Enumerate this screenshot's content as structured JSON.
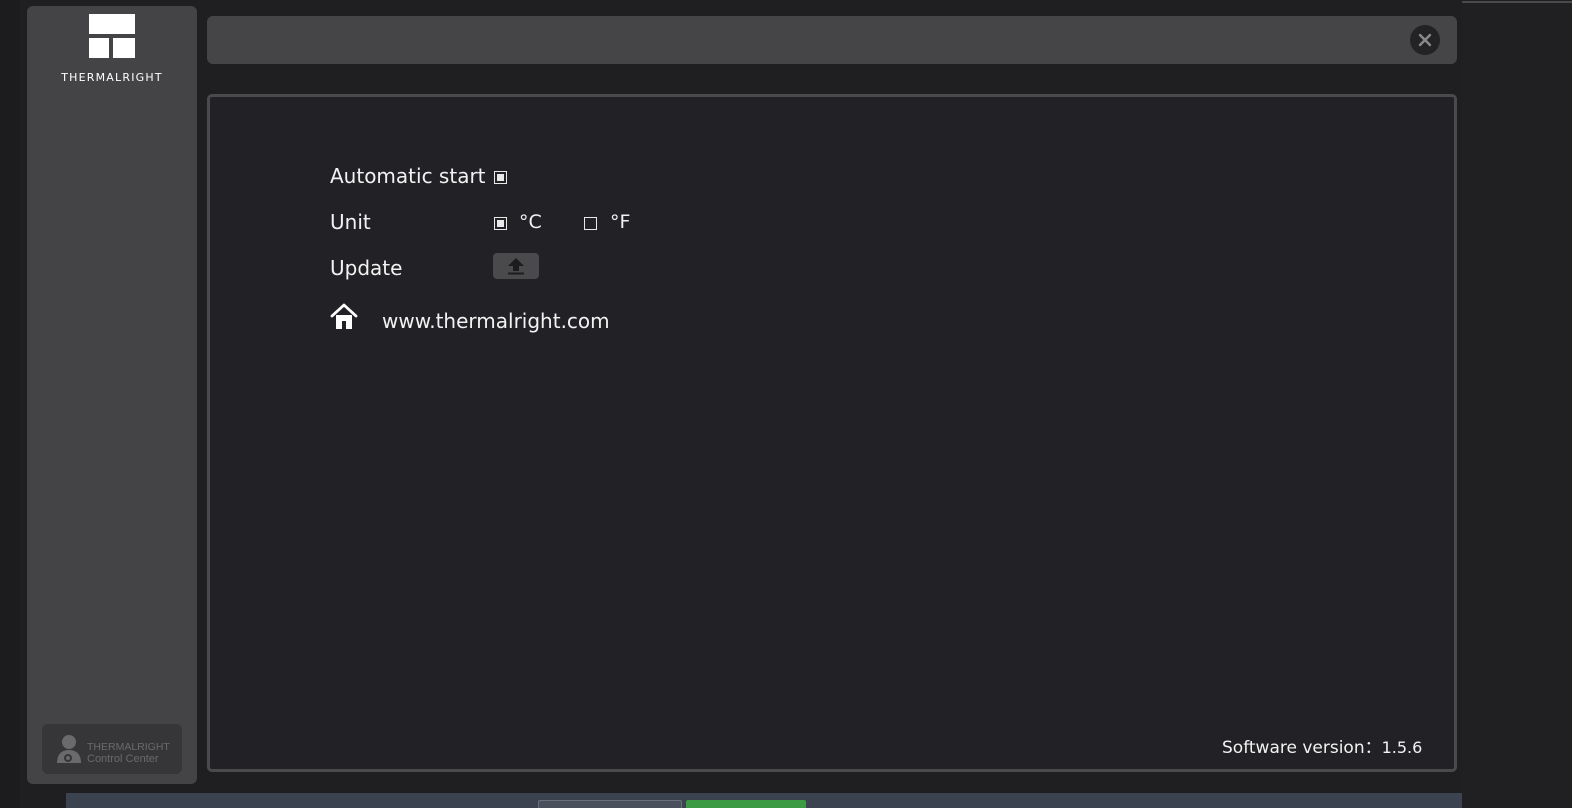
{
  "app": {
    "logo_text": "THERMALRIGHT",
    "badge_line1": "THERMALRIGHT",
    "badge_line2": "Control Center"
  },
  "settings": {
    "automatic_start": {
      "label": "Automatic start",
      "checked": true
    },
    "unit": {
      "label": "Unit",
      "celsius": {
        "label": "°C",
        "checked": true
      },
      "fahrenheit": {
        "label": "°F",
        "checked": false
      }
    },
    "update": {
      "label": "Update",
      "icon": "upload-icon"
    },
    "website": {
      "icon": "home-icon",
      "label": "www.thermalright.com"
    }
  },
  "footer": {
    "version_label": "Software version：",
    "version_value": "1.5.6"
  },
  "colors": {
    "panel_bg": "#222226",
    "sidebar_bg": "#444446",
    "titlebar_bg": "#454547",
    "text": "#f2f2f2"
  }
}
